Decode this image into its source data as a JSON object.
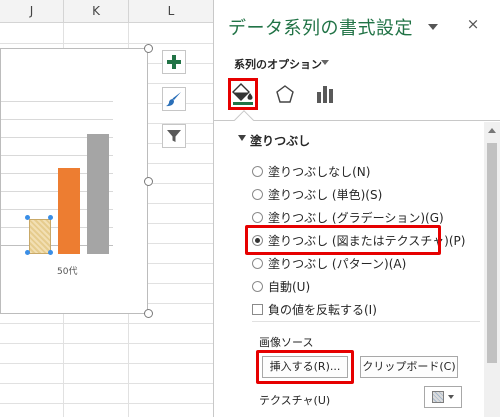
{
  "sheet": {
    "columns": [
      "J",
      "K",
      "L"
    ]
  },
  "chart": {
    "category_label": "50代",
    "selected_series": "patterned-bar",
    "colors": {
      "selected_fill": "#e9d29b",
      "series2": "#ed7d31",
      "series3": "#a5a5a5"
    }
  },
  "chart_buttons": {
    "elements": "plus-icon",
    "styles": "brush-icon",
    "filters": "filter-icon"
  },
  "pane": {
    "title": "データ系列の書式設定",
    "close": "×",
    "series_options": "系列のオプション",
    "tabs": [
      "fill-line-icon",
      "effects-pentagon-icon",
      "series-options-bars-icon"
    ],
    "section_title": "塗りつぶし",
    "fill_options": [
      {
        "label": "塗りつぶしなし(N)",
        "checked": false
      },
      {
        "label": "塗りつぶし (単色)(S)",
        "checked": false
      },
      {
        "label": "塗りつぶし (グラデーション)(G)",
        "checked": false
      },
      {
        "label": "塗りつぶし (図またはテクスチャ)(P)",
        "checked": true
      },
      {
        "label": "塗りつぶし (パターン)(A)",
        "checked": false
      },
      {
        "label": "自動(U)",
        "checked": false
      }
    ],
    "invert_if_negative": "負の値を反転する(I)",
    "image_source_label": "画像ソース",
    "insert_button": "挿入する(R)...",
    "clipboard_button": "クリップボード(C)",
    "texture_label": "テクスチャ(U)",
    "accent_color": "#217346",
    "highlight_color": "#e60000"
  }
}
